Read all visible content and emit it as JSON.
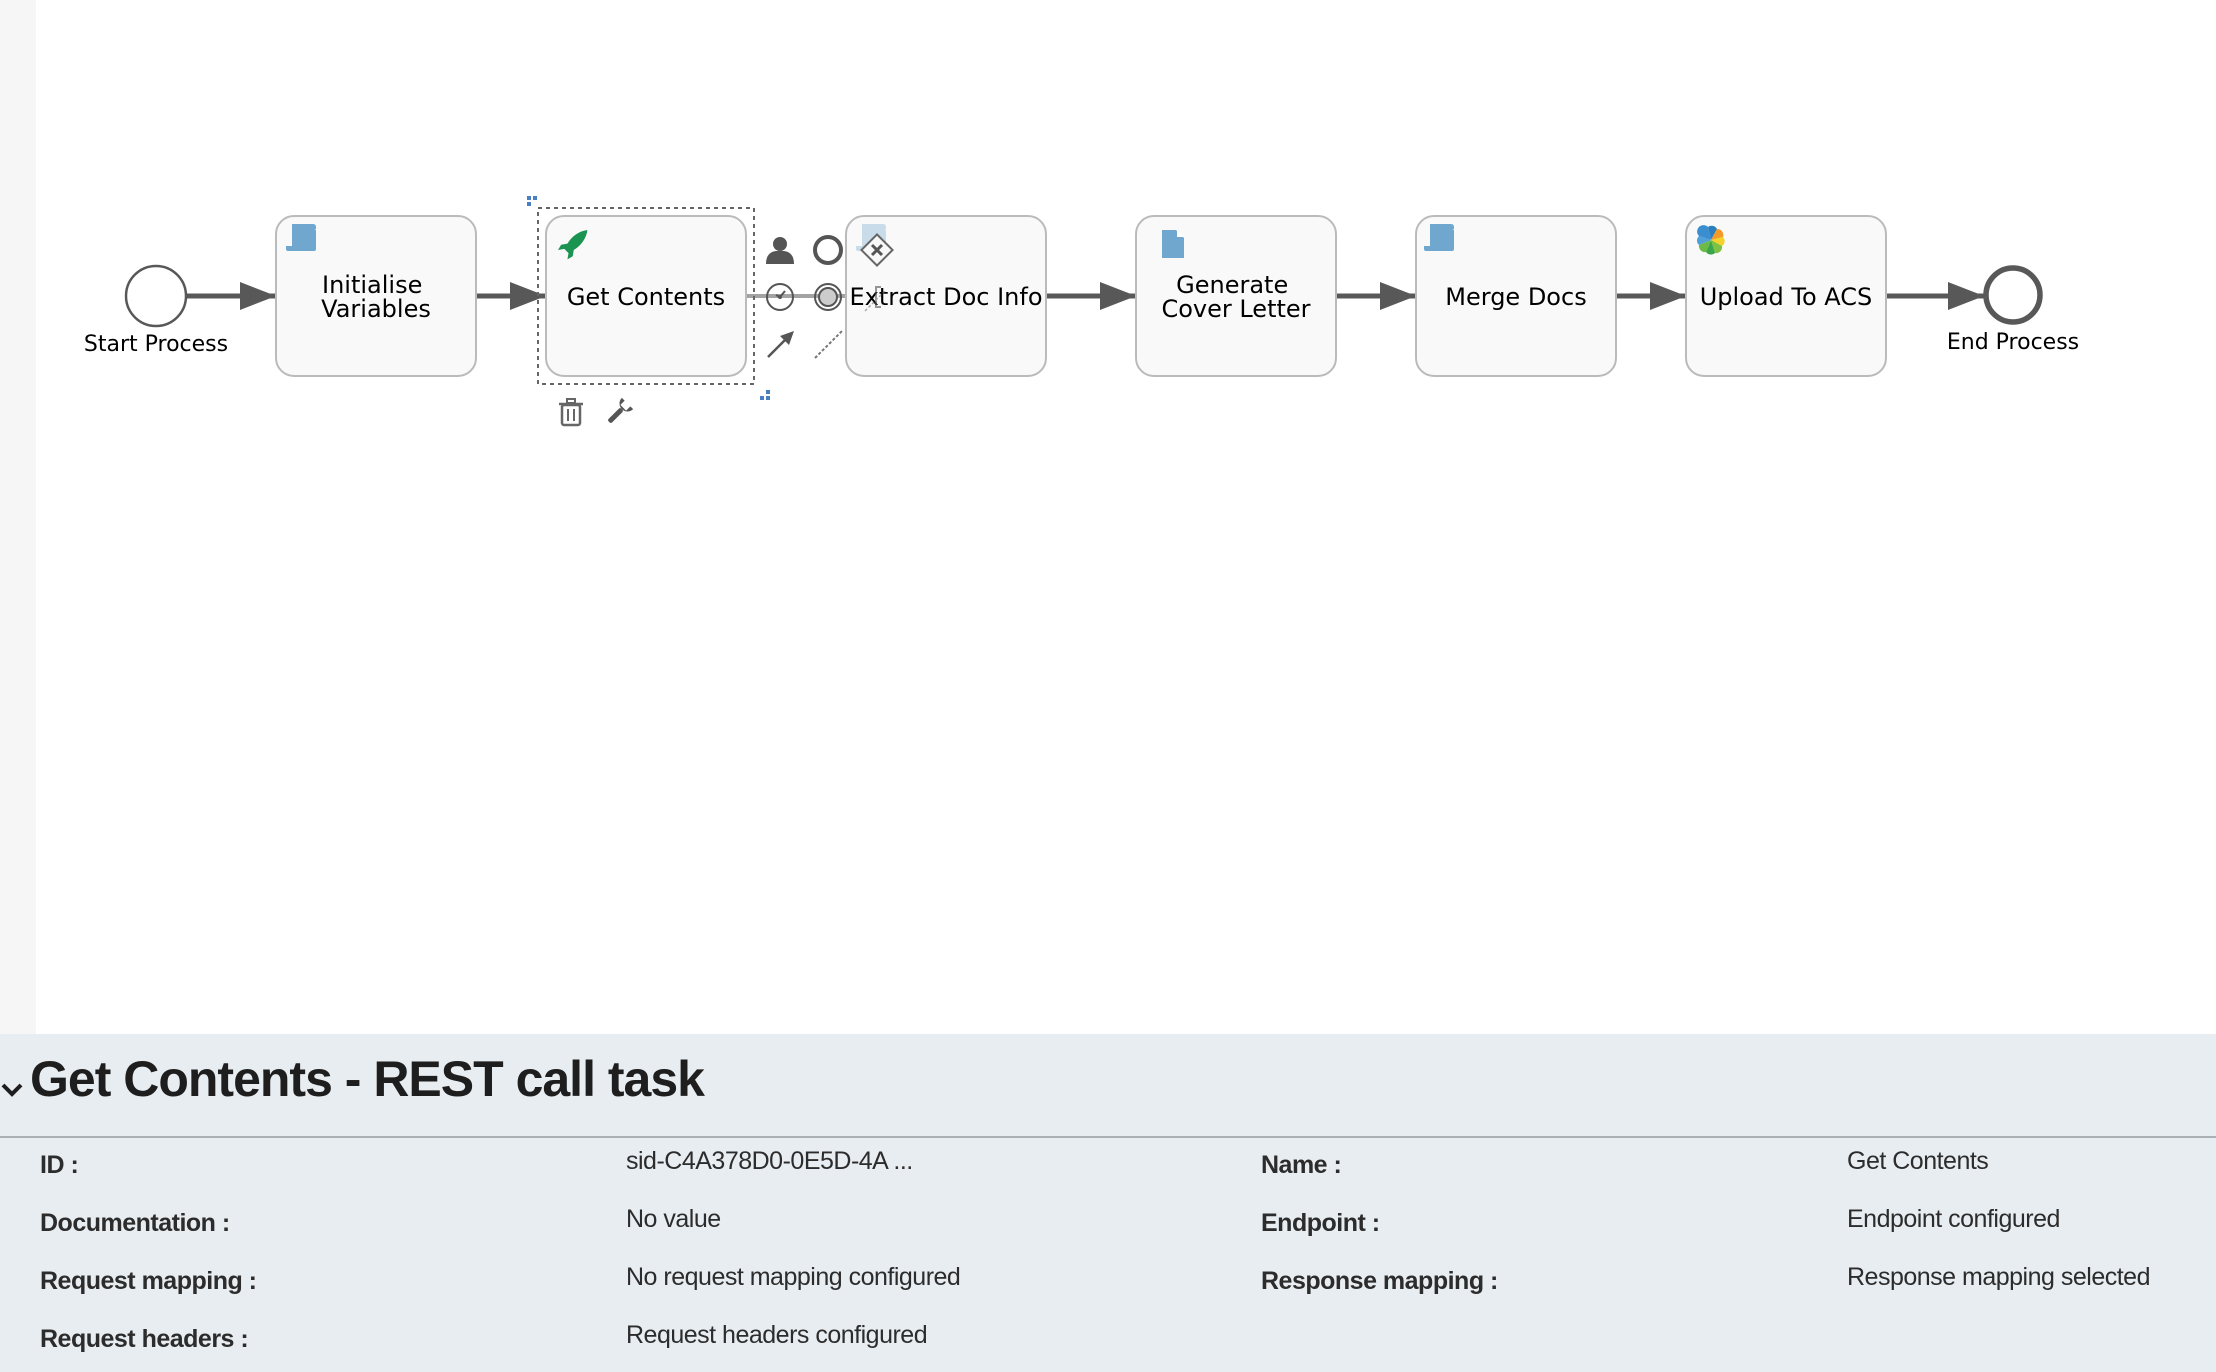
{
  "diagram": {
    "start_event": {
      "label": "Start Process",
      "icon": "none-start-event"
    },
    "end_event": {
      "label": "End Process",
      "icon": "none-end-event"
    },
    "tasks": [
      {
        "id": "initialise",
        "lines": [
          "Initialise",
          "Variables"
        ],
        "icon": "script-task-icon",
        "type": "Script task"
      },
      {
        "id": "get-contents",
        "lines": [
          "Get Contents"
        ],
        "icon": "rest-call-rocket-icon",
        "type": "REST call task",
        "selected": true
      },
      {
        "id": "extract-doc-info",
        "lines": [
          "Extract Doc Info"
        ],
        "icon": "script-task-icon",
        "type": "Script task"
      },
      {
        "id": "generate-cover-letter",
        "lines": [
          "Generate",
          "Cover Letter"
        ],
        "icon": "document-icon",
        "type": "Generate document task"
      },
      {
        "id": "merge-docs",
        "lines": [
          "Merge Docs"
        ],
        "icon": "script-task-icon",
        "type": "Script task"
      },
      {
        "id": "upload-to-acs",
        "lines": [
          "Upload To ACS"
        ],
        "icon": "alfresco-icon",
        "type": "Publish to Alfresco task"
      }
    ],
    "colors": {
      "task_fill": "#f9f9f9",
      "task_stroke": "#bbbbbb",
      "flow": "#585858",
      "script_icon": "#6fa7ce",
      "rocket_icon": "#1a9450"
    },
    "quick_palette": [
      "user-task-icon",
      "end-event-icon",
      "exclusive-gateway-icon",
      "timer-event-icon",
      "intermediate-event-icon",
      "text-annotation-icon",
      "sequence-flow-icon",
      "association-icon"
    ],
    "context_actions": [
      "delete-icon",
      "properties-wrench-icon"
    ]
  },
  "properties": {
    "title": "Get Contents - REST call task",
    "left": [
      {
        "label": "ID :",
        "value": "sid-C4A378D0-0E5D-4A ..."
      },
      {
        "label": "Documentation :",
        "value": "No value"
      },
      {
        "label": "Request mapping :",
        "value": "No request mapping configured"
      },
      {
        "label": "Request headers :",
        "value": "Request headers configured"
      }
    ],
    "right": [
      {
        "label": "Name :",
        "value": "Get Contents"
      },
      {
        "label": "Endpoint :",
        "value": "Endpoint configured"
      },
      {
        "label": "Response mapping :",
        "value": "Response mapping selected"
      }
    ]
  }
}
